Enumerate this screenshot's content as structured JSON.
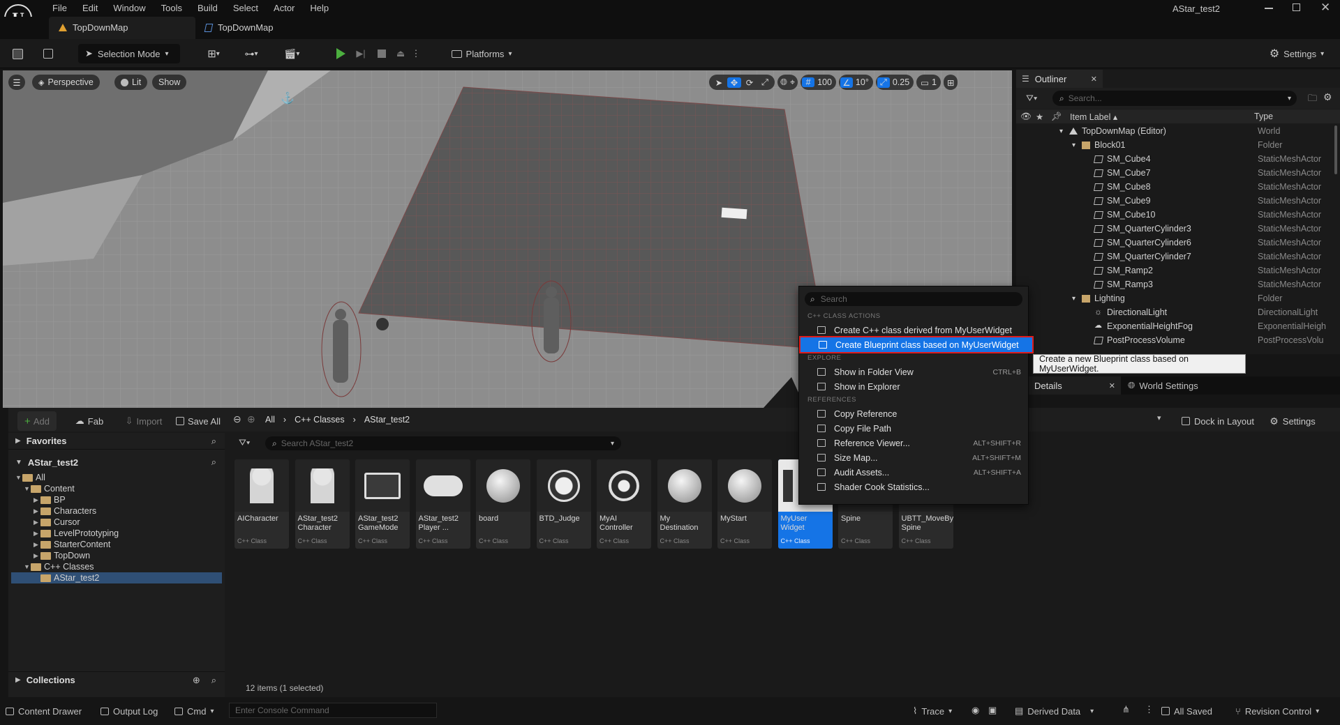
{
  "app": {
    "window_title": "AStar_test2"
  },
  "menu": [
    "File",
    "Edit",
    "Window",
    "Tools",
    "Build",
    "Select",
    "Actor",
    "Help"
  ],
  "tabs": [
    {
      "label": "TopDownMap",
      "active": true
    },
    {
      "label": "TopDownMap",
      "active": false
    }
  ],
  "toolbar": {
    "selection_mode": "Selection Mode",
    "platforms": "Platforms",
    "settings": "Settings"
  },
  "viewport": {
    "perspective": "Perspective",
    "lit": "Lit",
    "show": "Show",
    "grid_snap": "100",
    "angle_snap": "10°",
    "scale_snap": "0.25",
    "camera_speed": "1"
  },
  "outliner": {
    "title": "Outliner",
    "search_placeholder": "Search...",
    "col_label": "Item Label",
    "col_type": "Type",
    "rows": [
      {
        "label": "TopDownMap (Editor)",
        "type": "World",
        "indent": 0,
        "kind": "world"
      },
      {
        "label": "Block01",
        "type": "Folder",
        "indent": 1,
        "kind": "folder"
      },
      {
        "label": "SM_Cube4",
        "type": "StaticMeshActor",
        "indent": 2,
        "kind": "mesh"
      },
      {
        "label": "SM_Cube7",
        "type": "StaticMeshActor",
        "indent": 2,
        "kind": "mesh"
      },
      {
        "label": "SM_Cube8",
        "type": "StaticMeshActor",
        "indent": 2,
        "kind": "mesh"
      },
      {
        "label": "SM_Cube9",
        "type": "StaticMeshActor",
        "indent": 2,
        "kind": "mesh"
      },
      {
        "label": "SM_Cube10",
        "type": "StaticMeshActor",
        "indent": 2,
        "kind": "mesh"
      },
      {
        "label": "SM_QuarterCylinder3",
        "type": "StaticMeshActor",
        "indent": 2,
        "kind": "mesh"
      },
      {
        "label": "SM_QuarterCylinder6",
        "type": "StaticMeshActor",
        "indent": 2,
        "kind": "mesh"
      },
      {
        "label": "SM_QuarterCylinder7",
        "type": "StaticMeshActor",
        "indent": 2,
        "kind": "mesh"
      },
      {
        "label": "SM_Ramp2",
        "type": "StaticMeshActor",
        "indent": 2,
        "kind": "mesh"
      },
      {
        "label": "SM_Ramp3",
        "type": "StaticMeshActor",
        "indent": 2,
        "kind": "mesh"
      },
      {
        "label": "Lighting",
        "type": "Folder",
        "indent": 1,
        "kind": "folder"
      },
      {
        "label": "DirectionalLight",
        "type": "DirectionalLight",
        "indent": 2,
        "kind": "light"
      },
      {
        "label": "ExponentialHeightFog",
        "type": "ExponentialHeigh",
        "indent": 2,
        "kind": "fog"
      },
      {
        "label": "PostProcessVolume",
        "type": "PostProcessVolu",
        "indent": 2,
        "kind": "mesh"
      }
    ]
  },
  "details": {
    "tab_details": "Details",
    "tab_world": "World Settings"
  },
  "content_browser": {
    "add": "Add",
    "fab": "Fab",
    "import": "Import",
    "save_all": "Save All",
    "path": [
      "All",
      "C++ Classes",
      "AStar_test2"
    ],
    "dock": "Dock in Layout",
    "settings": "Settings",
    "favorites": "Favorites",
    "project": "AStar_test2",
    "search_placeholder": "Search AStar_test2",
    "tree": [
      {
        "label": "All",
        "indent": 0
      },
      {
        "label": "Content",
        "indent": 1
      },
      {
        "label": "BP",
        "indent": 2
      },
      {
        "label": "Characters",
        "indent": 2
      },
      {
        "label": "Cursor",
        "indent": 2
      },
      {
        "label": "LevelPrototyping",
        "indent": 2
      },
      {
        "label": "StarterContent",
        "indent": 2
      },
      {
        "label": "TopDown",
        "indent": 2
      },
      {
        "label": "C++ Classes",
        "indent": 1
      },
      {
        "label": "AStar_test2",
        "indent": 2
      }
    ],
    "collections": "Collections",
    "item_count": "12 items (1 selected)",
    "tiles": [
      {
        "name": "AICharacter",
        "kind": "C++ Class",
        "icon": "person-icon"
      },
      {
        "name": "AStar_test2 Character",
        "kind": "C++ Class",
        "icon": "person-icon"
      },
      {
        "name": "AStar_test2 GameMode",
        "kind": "C++ Class",
        "icon": "monitor-gamepad-icon"
      },
      {
        "name": "AStar_test2 Player ...",
        "kind": "C++ Class",
        "icon": "gamepad-icon"
      },
      {
        "name": "board",
        "kind": "C++ Class",
        "icon": "sphere-icon"
      },
      {
        "name": "BTD_Judge",
        "kind": "C++ Class",
        "icon": "cube-icon"
      },
      {
        "name": "MyAI Controller",
        "kind": "C++ Class",
        "icon": "ai-controller-icon"
      },
      {
        "name": "My Destination",
        "kind": "C++ Class",
        "icon": "sphere-icon"
      },
      {
        "name": "MyStart",
        "kind": "C++ Class",
        "icon": "sphere-icon"
      },
      {
        "name": "MyUser Widget",
        "kind": "C++ Class",
        "icon": "widget-icon",
        "selected": true
      },
      {
        "name": "Spine",
        "kind": "C++ Class",
        "icon": "none"
      },
      {
        "name": "UBTT_MoveBy Spine",
        "kind": "C++ Class",
        "icon": "none"
      }
    ]
  },
  "context_menu": {
    "search_placeholder": "Search",
    "sec_cpp": "C++ CLASS ACTIONS",
    "create_cpp": "Create C++ class derived from MyUserWidget",
    "create_bp": "Create Blueprint class based on MyUserWidget",
    "sec_explore": "EXPLORE",
    "show_folder": "Show in Folder View",
    "show_folder_sc": "CTRL+B",
    "show_explorer": "Show in Explorer",
    "sec_refs": "REFERENCES",
    "copy_ref": "Copy Reference",
    "copy_path": "Copy File Path",
    "ref_viewer": "Reference Viewer...",
    "ref_viewer_sc": "ALT+SHIFT+R",
    "size_map": "Size Map...",
    "size_map_sc": "ALT+SHIFT+M",
    "audit": "Audit Assets...",
    "audit_sc": "ALT+SHIFT+A",
    "shader_cook": "Shader Cook Statistics..."
  },
  "tooltip": "Create a new Blueprint class based on MyUserWidget.",
  "status": {
    "content_drawer": "Content Drawer",
    "output_log": "Output Log",
    "cmd": "Cmd",
    "console_placeholder": "Enter Console Command",
    "trace": "Trace",
    "derived_data": "Derived Data",
    "all_saved": "All Saved",
    "revision_control": "Revision Control"
  }
}
